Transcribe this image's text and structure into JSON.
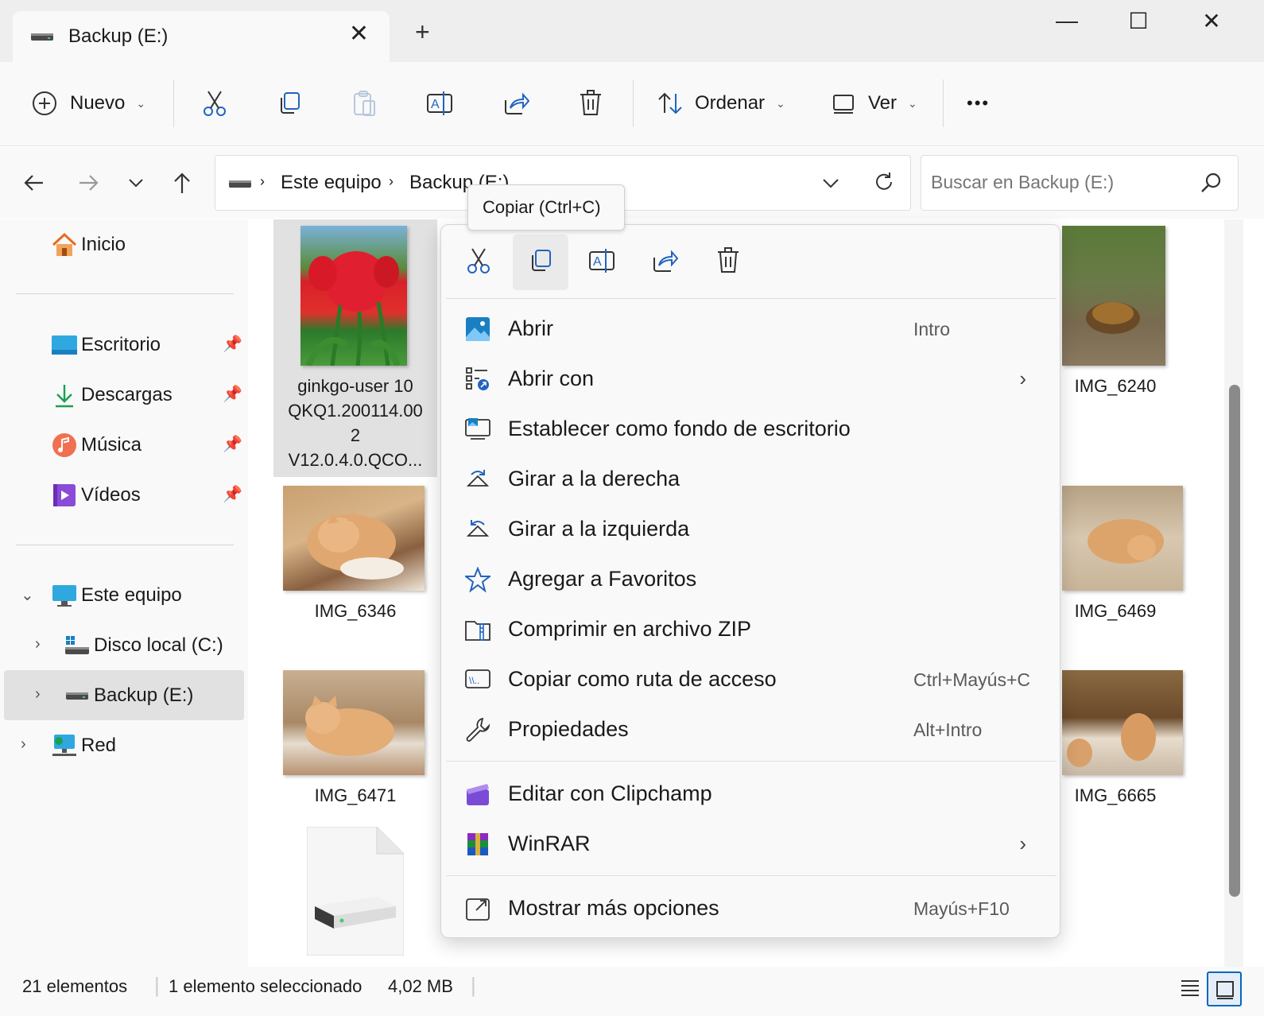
{
  "tab": {
    "title": "Backup (E:)",
    "close_icon": "close-icon",
    "new_tab_icon": "plus-icon"
  },
  "window_controls": {
    "minimize": "—",
    "maximize": "☐",
    "close": "✕"
  },
  "commandbar": {
    "new_label": "Nuevo",
    "sort_label": "Ordenar",
    "view_label": "Ver",
    "more_label": "•••"
  },
  "address": {
    "segments": [
      "Este equipo",
      "Backup (E:)"
    ]
  },
  "search": {
    "placeholder": "Buscar en Backup (E:)"
  },
  "sidebar": {
    "home": "Inicio",
    "quick": [
      "Escritorio",
      "Descargas",
      "Música",
      "Vídeos"
    ],
    "this_pc": "Este equipo",
    "drives": [
      "Disco local (C:)",
      "Backup (E:)"
    ],
    "network": "Red"
  },
  "files": {
    "selected_label_lines": [
      "ginkgo-user 10",
      "QKQ1.200114.00",
      "2",
      "V12.0.4.0.QCO..."
    ],
    "items": [
      "IMG_6240",
      "IMG_6346",
      "IMG_6469",
      "IMG_6471",
      "IMG_6665"
    ]
  },
  "tooltip": "Copiar (Ctrl+C)",
  "context_menu": {
    "items": [
      {
        "label": "Abrir",
        "shortcut": "Intro"
      },
      {
        "label": "Abrir con",
        "shortcut": ""
      },
      {
        "label": "Establecer como fondo de escritorio",
        "shortcut": ""
      },
      {
        "label": "Girar a la derecha",
        "shortcut": ""
      },
      {
        "label": "Girar a la izquierda",
        "shortcut": ""
      },
      {
        "label": "Agregar a Favoritos",
        "shortcut": ""
      },
      {
        "label": "Comprimir en archivo ZIP",
        "shortcut": ""
      },
      {
        "label": "Copiar como ruta de acceso",
        "shortcut": "Ctrl+Mayús+C"
      },
      {
        "label": "Propiedades",
        "shortcut": "Alt+Intro"
      },
      {
        "label": "Editar con Clipchamp",
        "shortcut": ""
      },
      {
        "label": "WinRAR",
        "shortcut": ""
      },
      {
        "label": "Mostrar más opciones",
        "shortcut": "Mayús+F10"
      }
    ]
  },
  "status": {
    "count": "21 elementos",
    "selection": "1 elemento seleccionado",
    "size": "4,02 MB"
  },
  "colors": {
    "accent": "#0067c0",
    "selection": "#e1e1e1"
  }
}
